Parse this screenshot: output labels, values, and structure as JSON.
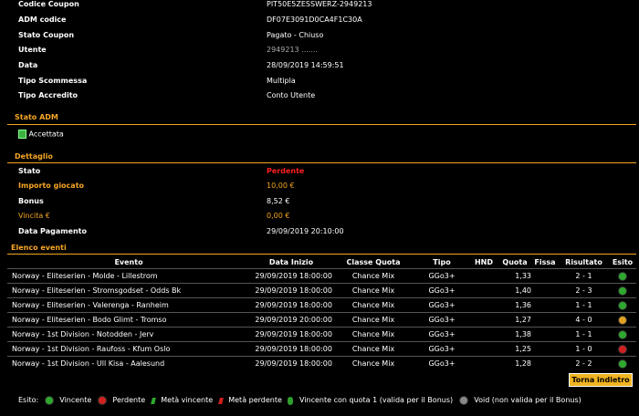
{
  "info": [
    {
      "label": "Codice Coupon",
      "value": "PIT50E5ZESSWERZ-2949213"
    },
    {
      "label": "ADM codice",
      "value": "DF07E3091D0CA4F1C30A"
    },
    {
      "label": "Stato Coupon",
      "value": "Pagato - Chiuso"
    },
    {
      "label": "Utente",
      "value": "2949213 ....... "
    },
    {
      "label": "Data",
      "value": "28/09/2019 14:59:51"
    },
    {
      "label": "Tipo Scommessa",
      "value": "Multipla"
    },
    {
      "label": "Tipo Accredito",
      "value": "Conto Utente"
    }
  ],
  "stato_adm": {
    "title": "Stato ADM",
    "status": "Accettata"
  },
  "dettaglio": {
    "title": "Dettaglio",
    "stato": {
      "label": "Stato",
      "value": "Perdente"
    },
    "importo": {
      "label": "Importo giocato",
      "value": "10,00 €"
    },
    "bonus": {
      "label": "Bonus",
      "value": "8,52 €"
    },
    "vincita": {
      "label": "Vincita €",
      "value": "0,00 €"
    },
    "pagamento": {
      "label": "Data Pagamento",
      "value": "29/09/2019 20:10:00"
    }
  },
  "eventi": {
    "title": "Elenco eventi",
    "headers": [
      "Evento",
      "Data Inizio",
      "Classe Quota",
      "Tipo",
      "HND",
      "Quota",
      "Fissa",
      "Risultato",
      "Esito"
    ],
    "rows": [
      {
        "evento": "Norway - Eliteserien - Molde - Lillestrom",
        "data": "29/09/2019 18:00:00",
        "classe": "Chance Mix",
        "tipo": "GGo3+",
        "hnd": "",
        "quota": "1,33",
        "fissa": "",
        "risultato": "2 - 1",
        "esito": "#2ea82e"
      },
      {
        "evento": "Norway - Eliteserien - Stromsgodset - Odds Bk",
        "data": "29/09/2019 18:00:00",
        "classe": "Chance Mix",
        "tipo": "GGo3+",
        "hnd": "",
        "quota": "1,40",
        "fissa": "",
        "risultato": "2 - 3",
        "esito": "#2ea82e"
      },
      {
        "evento": "Norway - Eliteserien - Valerenga - Ranheim",
        "data": "29/09/2019 18:00:00",
        "classe": "Chance Mix",
        "tipo": "GGo3+",
        "hnd": "",
        "quota": "1,36",
        "fissa": "",
        "risultato": "1 - 1",
        "esito": "#2ea82e"
      },
      {
        "evento": "Norway - Eliteserien - Bodo Glimt - Tromso",
        "data": "29/09/2019 20:00:00",
        "classe": "Chance Mix",
        "tipo": "GGo3+",
        "hnd": "",
        "quota": "1,27",
        "fissa": "",
        "risultato": "4 - 0",
        "esito": "#e0a020"
      },
      {
        "evento": "Norway - 1st Division - Notodden - Jerv",
        "data": "29/09/2019 18:00:00",
        "classe": "Chance Mix",
        "tipo": "GGo3+",
        "hnd": "",
        "quota": "1,38",
        "fissa": "",
        "risultato": "1 - 1",
        "esito": "#2ea82e"
      },
      {
        "evento": "Norway - 1st Division - Raufoss - Kfum Oslo",
        "data": "29/09/2019 18:00:00",
        "classe": "Chance Mix",
        "tipo": "GGo3+",
        "hnd": "",
        "quota": "1,25",
        "fissa": "",
        "risultato": "1 - 0",
        "esito": "#d02020"
      },
      {
        "evento": "Norway - 1st Division - Ull Kisa - Aalesund",
        "data": "29/09/2019 18:00:00",
        "classe": "Chance Mix",
        "tipo": "GGo3+",
        "hnd": "",
        "quota": "1,28",
        "fissa": "",
        "risultato": "2 - 2",
        "esito": "#2ea82e"
      }
    ]
  },
  "back_button": "Torna indietro",
  "legend": {
    "title": "Esito:",
    "vincente": "Vincente",
    "perdente": "Perdente",
    "meta_vincente": "Metà vincente",
    "meta_perdente": "Metà perdente",
    "quota1": "Vincente con quota 1 (valida per il Bonus)",
    "void": "Void (non valida per il Bonus)"
  },
  "colors": {
    "accent": "#f5a623",
    "lost": "#ff2020",
    "win": "#2ea82e",
    "half": "#e0a020",
    "button": "#f0b420"
  }
}
